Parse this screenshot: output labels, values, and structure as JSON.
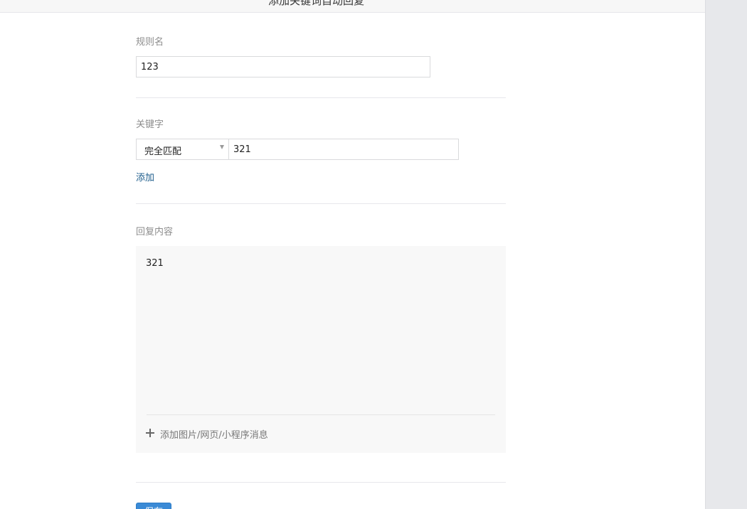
{
  "header": {
    "title": "添加关键词自动回复"
  },
  "form": {
    "rule_name": {
      "label": "规则名",
      "value": "123"
    },
    "keyword": {
      "label": "关键字",
      "match_mode": "完全匹配",
      "value": "321",
      "add_link": "添加"
    },
    "reply": {
      "label": "回复内容",
      "content": "321",
      "attach_label": "添加图片/网页/小程序消息"
    },
    "save_label": "保存"
  },
  "icons": {
    "select_arrow": "triangle-down-icon",
    "attach": "plus-icon"
  },
  "colors": {
    "link": "#1e5d8c",
    "primary_button": "#3a8ad6",
    "reply_background": "#f8f8f8",
    "right_rail": "#e7e8eb"
  }
}
